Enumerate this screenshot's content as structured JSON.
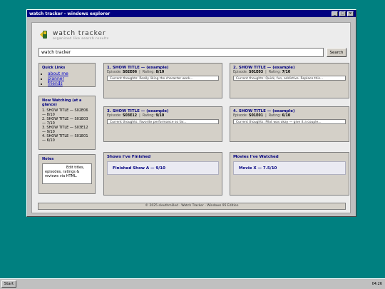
{
  "window": {
    "title": "watch tracker - windows explorer",
    "controls": [
      "_",
      "□",
      "×"
    ]
  },
  "header": {
    "title": "watch tracker",
    "tagline": "organized like search results"
  },
  "search": {
    "value": "watch tracker",
    "button": "Search"
  },
  "sidebar": {
    "quick_links": {
      "title": "Quick Links",
      "items": [
        "about me",
        "planner",
        "friends"
      ]
    },
    "now_watching": {
      "title": "Now Watching (at a glance)",
      "items": [
        "1. SHOW TITLE — S02E06 — 8/10",
        "2. SHOW TITLE — S01E03 — 7/10",
        "3. SHOW TITLE — S03E12 — 9/10",
        "4. SHOW TITLE — S01E01 — 6/10"
      ]
    },
    "notes": {
      "title": "Notes",
      "text": "Edit titles, episodes, ratings & reviews via HTML."
    }
  },
  "cards": [
    {
      "title": "1. SHOW TITLE — (example)",
      "episode_label": "Episode:",
      "episode": "S02E06",
      "rating_label": "Rating:",
      "rating": "8/10",
      "thought": "Current thoughts: Really liking the character work..."
    },
    {
      "title": "2. SHOW TITLE — (example)",
      "episode_label": "Episode:",
      "episode": "S01E03",
      "rating_label": "Rating:",
      "rating": "7/10",
      "thought": "Current thoughts: Quick, fun, addictive. Replace this..."
    },
    {
      "title": "3. SHOW TITLE — (example)",
      "episode_label": "Episode:",
      "episode": "S03E12",
      "rating_label": "Rating:",
      "rating": "9/10",
      "thought": "Current thoughts: Favorite performance so far..."
    },
    {
      "title": "4. SHOW TITLE — (example)",
      "episode_label": "Episode:",
      "episode": "S01E01",
      "rating_label": "Rating:",
      "rating": "6/10",
      "thought": "Current thoughts: Pilot was okay — give it a couple..."
    }
  ],
  "finished": {
    "title": "Shows I've Finished",
    "item": "Finished Show A — 9/10"
  },
  "movies": {
    "title": "Movies I've Watched",
    "item": "Movie X — 7.5/10"
  },
  "footer": {
    "text": "© 2025 sleuthmilled · Watch Tracker · Windows 95 Edition"
  },
  "taskbar": {
    "start": "Start",
    "clock": "04:26"
  },
  "colors": {
    "desktop": "#008080",
    "titlebar": "#000080",
    "panel": "#d4d0c8"
  }
}
